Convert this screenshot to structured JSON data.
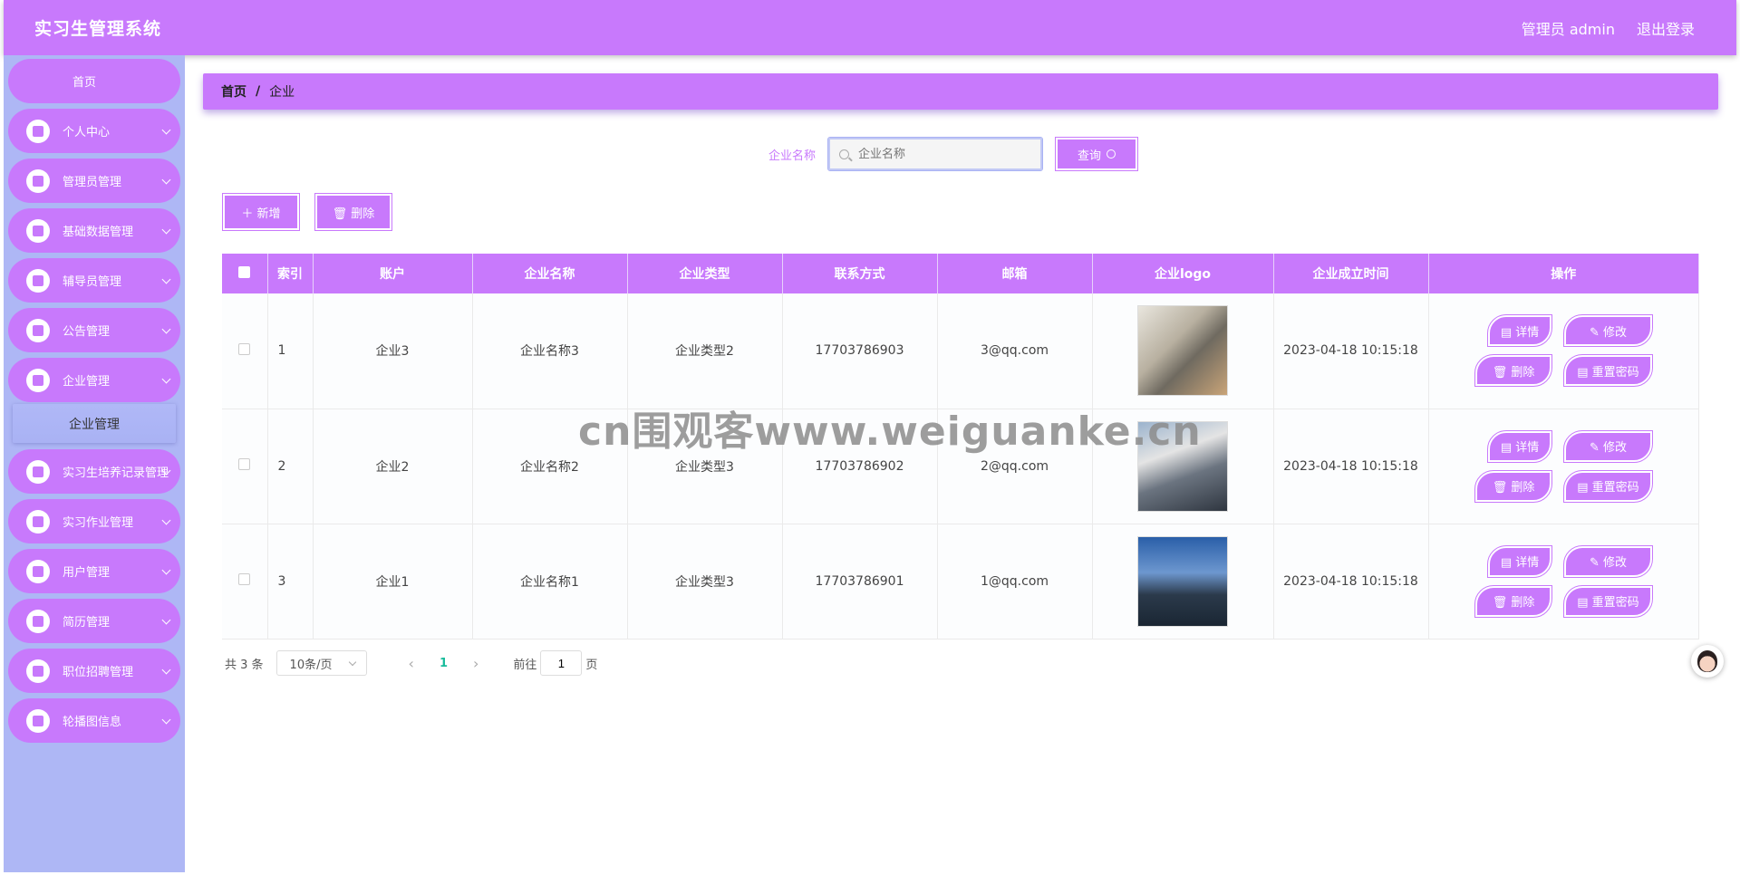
{
  "header": {
    "title": "实习生管理系统",
    "user": "管理员 admin",
    "logout": "退出登录"
  },
  "sidebar": {
    "home": "首页",
    "items": [
      {
        "label": "个人中心",
        "icon": "user-icon"
      },
      {
        "label": "管理员管理",
        "icon": "clipboard-icon"
      },
      {
        "label": "基础数据管理",
        "icon": "sliders-icon"
      },
      {
        "label": "辅导员管理",
        "icon": "grid-icon"
      },
      {
        "label": "公告管理",
        "icon": "clipboard-check-icon"
      },
      {
        "label": "企业管理",
        "icon": "dots-grid-icon"
      }
    ],
    "submenu_active": "企业管理",
    "items_after": [
      {
        "label": "实习生培养记录管理",
        "icon": "list-icon"
      },
      {
        "label": "实习作业管理",
        "icon": "grid-icon"
      },
      {
        "label": "用户管理",
        "icon": "bulb-icon"
      },
      {
        "label": "简历管理",
        "icon": "grid-icon"
      },
      {
        "label": "职位招聘管理",
        "icon": "grid-icon"
      },
      {
        "label": "轮播图信息",
        "icon": "list-icon"
      }
    ]
  },
  "breadcrumb": {
    "home": "首页",
    "sep": "/",
    "current": "企业"
  },
  "search": {
    "label": "企业名称",
    "placeholder": "企业名称",
    "button": "查询"
  },
  "actions": {
    "add": "＋ 新增",
    "delete": "🗑 删除"
  },
  "table": {
    "headers": [
      "索引",
      "账户",
      "企业名称",
      "企业类型",
      "联系方式",
      "邮箱",
      "企业logo",
      "企业成立时间",
      "操作"
    ],
    "rows": [
      {
        "index": "1",
        "account": "企业3",
        "name": "企业名称3",
        "type": "企业类型2",
        "phone": "17703786903",
        "email": "3@qq.com",
        "time": "2023-04-18 10:15:18"
      },
      {
        "index": "2",
        "account": "企业2",
        "name": "企业名称2",
        "type": "企业类型3",
        "phone": "17703786902",
        "email": "2@qq.com",
        "time": "2023-04-18 10:15:18"
      },
      {
        "index": "3",
        "account": "企业1",
        "name": "企业名称1",
        "type": "企业类型3",
        "phone": "17703786901",
        "email": "1@qq.com",
        "time": "2023-04-18 10:15:18"
      }
    ],
    "ops": {
      "detail": "▤ 详情",
      "edit": "✎ 修改",
      "delete": "🗑 删除",
      "reset": "▤ 重置密码"
    }
  },
  "pager": {
    "total": "共 3 条",
    "page_size": "10条/页",
    "prev": "‹",
    "current": "1",
    "next": "›",
    "goto": "前往",
    "goto_value": "1",
    "page_unit": "页"
  },
  "watermark": "cn围观客www.weiguanke.cn",
  "colors": {
    "accent": "#c879fc",
    "sidebar": "#aeb7f5"
  }
}
